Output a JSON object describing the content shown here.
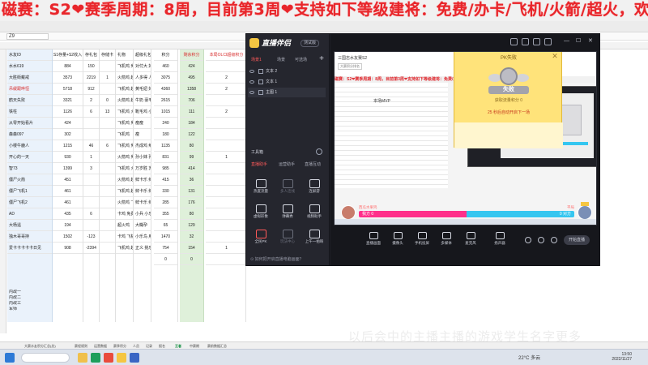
{
  "banner": {
    "text": "磁赛：S2❤赛季周期：8周，目前第3周❤支持如下等级建将：免费/办卡/飞机/火箭/超火，欢迎加入❤❤当前战役：三"
  },
  "spreadsheet": {
    "name_box": "Z9",
    "headers": {
      "name": "水友ID",
      "s1": "S1存量+S2收入",
      "s2": "存礼包",
      "s3": "存储卡",
      "gift": "礼物",
      "gift2": "超级礼包",
      "score": "积分",
      "rank": "剩余积分",
      "mark": "本局OLCI超级积分"
    },
    "names": [
      "水水619",
      "大胜街戴戒",
      "吊缓跟哗恒",
      "鹤天失败",
      "铁柱",
      "从零开始看片",
      "森森097",
      "小楼牛鹿人",
      "开心的一天",
      "智73",
      "僵尸火箭",
      "僵尸飞机1",
      "僵尸飞机2",
      "AD",
      "大杨遥",
      "独木哥哥持",
      "爱卡卡卡卡卡日见"
    ],
    "s1_values": [
      "884",
      "3573",
      "5718",
      "3321",
      "1126",
      "424",
      "302",
      "1215",
      "930",
      "1399",
      "451",
      "461",
      "461",
      "435",
      "194",
      "1502",
      "908"
    ],
    "s2_values": [
      "150",
      "2219",
      "912",
      "2",
      "6",
      "",
      "",
      "46",
      "1",
      "3",
      "",
      "",
      "",
      "6",
      "",
      "-123",
      "-2394"
    ],
    "s3_values": [
      "",
      "1",
      "",
      "0",
      "13",
      "",
      "",
      "6",
      "",
      "",
      "",
      "",
      "",
      "",
      "",
      "",
      ""
    ],
    "gift_values": [
      "飞机鸡 免费",
      "火箭鸡 超火鸡",
      "飞机鸡 超火鸡",
      "火箭鸡 超火鸡",
      "飞机鸡 火箭鸡",
      "飞机鸡 免费",
      "飞机鸡",
      "飞机鸡 免费",
      "火箭鸡 免费",
      "飞机鸡 火箭鸡",
      "火箭鸡 超火鸡",
      "飞机鸡 超火鸡",
      "火箭鸡 飞机鸡",
      "卡鸡 免费",
      "超火鸡",
      "卡鸡 飞机鸡",
      "飞机鸡 超火鸡"
    ],
    "gift2_values": [
      "对付大 好轻松",
      "人多得 人多得",
      "黄毛妞 好轻松",
      "牛奶 豪毛鸡",
      "靴毛鸡 小杀毛",
      "瘦瘦",
      "瘦",
      "杰成鸡 绝生",
      "孙小妹 孙小妹",
      "万岁胜 苏鲁大",
      "鲜卡乐 鲜卡乐",
      "鲜卡乐 鲜卡乐",
      "鲜卡乐 鲜卡乐",
      "小兵 小乐",
      "大糊孕",
      "小乐鸟 用幸",
      "正义 挑乐"
    ],
    "score_values": [
      "460",
      "3075",
      "4360",
      "2615",
      "1015",
      "240",
      "180",
      "1135",
      "831",
      "985",
      "415",
      "330",
      "285",
      "355",
      "65",
      "1470",
      "754",
      "0"
    ],
    "rank_values": [
      "424",
      "495",
      "1358",
      "706",
      "111",
      "184",
      "122",
      "80",
      "99",
      "414",
      "36",
      "131",
      "176",
      "80",
      "129",
      "32",
      "154",
      "0"
    ],
    "mark_values": [
      "",
      "2",
      "2",
      "",
      "2",
      "",
      "",
      "",
      "1",
      "",
      "",
      "",
      "",
      "",
      "",
      "",
      "1",
      ""
    ],
    "extra_rows": [
      "内政一",
      "内政二",
      "内政三",
      "军师"
    ],
    "sheet_tabs": [
      "大赛水友积分汇总(总)",
      "赛程规则",
      "运营数据",
      "赛季积分",
      "人员",
      "记录",
      "报名",
      "王者",
      "中赛期",
      "赛前数据汇总"
    ],
    "active_tab": "王者"
  },
  "app": {
    "name": "直播伴侣",
    "version": "测试版",
    "scene_tabs": [
      "场景1",
      "场景",
      "可选场"
    ],
    "layers": [
      "文本 2",
      "文本 1",
      "主图 1"
    ],
    "tools_title": "工具箱",
    "tool_tabs": [
      "直播助手",
      "运营助手",
      "直播互动"
    ],
    "tools": [
      {
        "label": "热度流量",
        "state": "on"
      },
      {
        "label": "多人连线",
        "state": "off"
      },
      {
        "label": "连屏游",
        "state": "on"
      },
      {
        "label": "虚拟形象",
        "state": "on"
      },
      {
        "label": "弹幕秀",
        "state": "on"
      },
      {
        "label": "视频助手",
        "state": "on"
      },
      {
        "label": "全民PK",
        "state": "hot"
      },
      {
        "label": "玩法中心",
        "state": "off"
      },
      {
        "label": "上午一拍响",
        "state": "on"
      }
    ],
    "side_footer": "⊙ 如何把开启直播电脑画面？",
    "bottom_tools": [
      "直播画面",
      "摄像头",
      "手机投屏",
      "多媒体",
      "麦克风",
      "扬声器"
    ],
    "go_live": "开始直播"
  },
  "preview": {
    "title": "三国志水友赛S2",
    "subtitle": "大赛积分排名",
    "banner": "磁赛：S2❤赛季周期：8周，目前第3周❤支持如下等级建将：免费/办卡/飞机/火箭/超火，欢迎加入❤❤当前战役：三",
    "mvp": "本场MVP",
    "pk": {
      "title": "PK失败",
      "result": "失败",
      "score": "获取流量积分 0",
      "next": "25 秒后自动开启下一场"
    },
    "pk_bar": {
      "left_name": "西瓜水果鸡",
      "right_name": "平局",
      "left_text": "我方 0",
      "right_text": "0 对方",
      "left_share": 0.5
    }
  },
  "taskbar": {
    "weather": "22°C 多云",
    "time": "13:50",
    "date": "2022/11/27"
  },
  "watermark": "以后会中的主播主播的游戏学生名字更多"
}
